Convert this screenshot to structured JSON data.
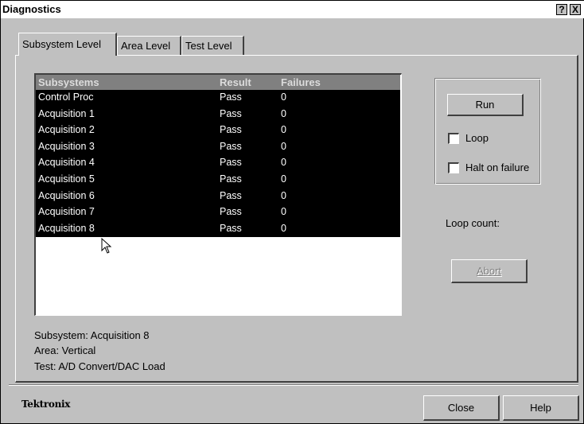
{
  "window": {
    "title": "Diagnostics",
    "help_button": "?",
    "close_button": "X"
  },
  "tabs": [
    {
      "label": "Subsystem Level",
      "active": true
    },
    {
      "label": "Area Level",
      "active": false
    },
    {
      "label": "Test Level",
      "active": false
    }
  ],
  "list": {
    "columns": [
      "Subsystems",
      "Result",
      "Failures"
    ],
    "rows": [
      {
        "subsystem": "Control Proc",
        "result": "Pass",
        "failures": "0"
      },
      {
        "subsystem": "Acquisition 1",
        "result": "Pass",
        "failures": "0"
      },
      {
        "subsystem": "Acquisition 2",
        "result": "Pass",
        "failures": "0"
      },
      {
        "subsystem": "Acquisition 3",
        "result": "Pass",
        "failures": "0"
      },
      {
        "subsystem": "Acquisition 4",
        "result": "Pass",
        "failures": "0"
      },
      {
        "subsystem": "Acquisition 5",
        "result": "Pass",
        "failures": "0"
      },
      {
        "subsystem": "Acquisition 6",
        "result": "Pass",
        "failures": "0"
      },
      {
        "subsystem": "Acquisition 7",
        "result": "Pass",
        "failures": "0"
      },
      {
        "subsystem": "Acquisition 8",
        "result": "Pass",
        "failures": "0"
      }
    ]
  },
  "controls": {
    "run_label": "Run",
    "loop_label": "Loop",
    "loop_checked": false,
    "halt_label": "Halt on failure",
    "halt_checked": false,
    "loop_count_label": "Loop count:",
    "abort_mnemonic": "A",
    "abort_rest": "bort",
    "abort_enabled": false
  },
  "status": {
    "subsystem": "Subsystem: Acquisition 8",
    "area": "Area: Vertical",
    "test": "Test: A/D Convert/DAC Load"
  },
  "footer": {
    "logo": "Tektronix",
    "close_label": "Close",
    "help_label": "Help"
  },
  "colors": {
    "dialog_bg": "#c0c0c0",
    "selection_bg": "#000000",
    "header_bg": "#808080"
  }
}
